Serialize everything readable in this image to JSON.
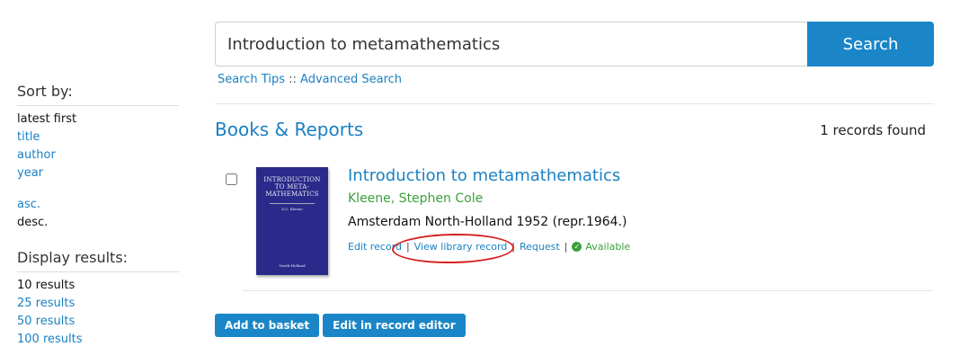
{
  "sidebar": {
    "sort_heading": "Sort by:",
    "sort_options": [
      "latest first",
      "title",
      "author",
      "year"
    ],
    "order_options": [
      "asc.",
      "desc."
    ],
    "display_heading": "Display results:",
    "display_options": [
      "10 results",
      "25 results",
      "50 results",
      "100 results"
    ]
  },
  "search": {
    "query": "Introduction to metamathematics",
    "button_label": "Search",
    "tips_link": "Search Tips",
    "separator": "::",
    "advanced_link": "Advanced Search"
  },
  "results": {
    "section_title": "Books & Reports",
    "records_found": "1 records found"
  },
  "record": {
    "cover": {
      "title_line1": "INTRODUCTION",
      "title_line2": "TO META-",
      "title_line3": "MATHEMATICS",
      "author": "S.C. Kleene",
      "publisher": "North-Holland"
    },
    "title": "Introduction to metamathematics",
    "author": "Kleene, Stephen Cole",
    "publication": "Amsterdam North-Holland 1952 (repr.1964.)",
    "actions": {
      "edit_record": "Edit record",
      "view_library_record": "View library record",
      "request": "Request",
      "available": "Available",
      "separator": "|"
    }
  },
  "buttons": {
    "add_to_basket": "Add to basket",
    "edit_in_record_editor": "Edit in record editor"
  },
  "colors": {
    "accent": "#1a86c8",
    "link": "#1a81c2",
    "author_green": "#3ba13b",
    "highlight_red": "#d62020",
    "cover_blue": "#2a2a8a"
  }
}
